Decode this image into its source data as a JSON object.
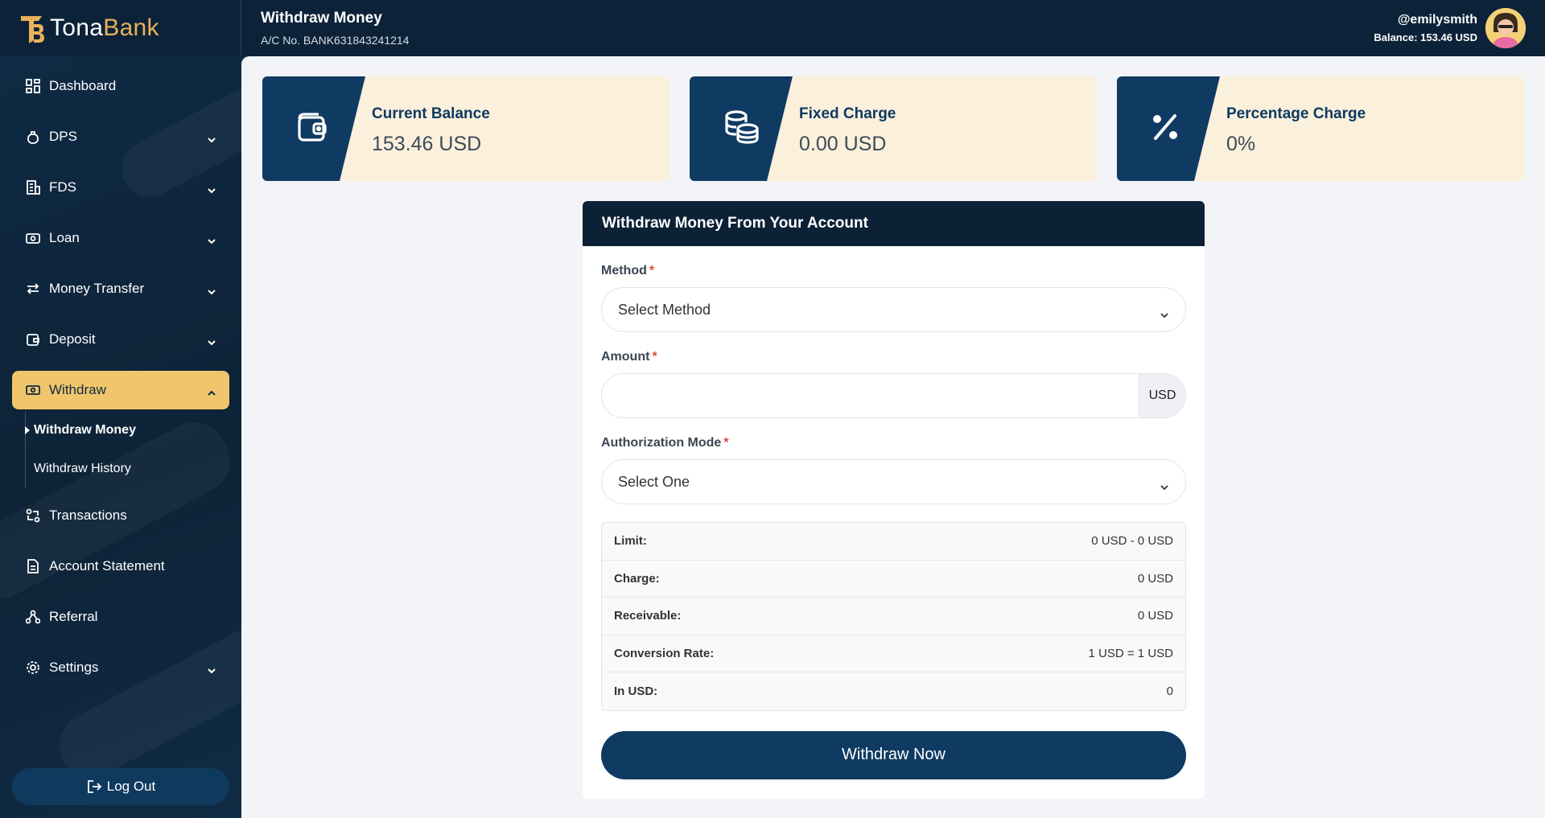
{
  "brand": {
    "part1": "Tona",
    "part2": "Bank"
  },
  "header": {
    "title": "Withdraw Money",
    "account": "A/C No. BANK631843241214",
    "username": "@emilysmith",
    "balance_label": "Balance:",
    "balance_value": "153.46 USD"
  },
  "sidebar": {
    "items": [
      {
        "label": "Dashboard"
      },
      {
        "label": "DPS"
      },
      {
        "label": "FDS"
      },
      {
        "label": "Loan"
      },
      {
        "label": "Money Transfer"
      },
      {
        "label": "Deposit"
      },
      {
        "label": "Withdraw"
      },
      {
        "label": "Transactions"
      },
      {
        "label": "Account Statement"
      },
      {
        "label": "Referral"
      },
      {
        "label": "Settings"
      }
    ],
    "withdraw_sub": [
      {
        "label": "Withdraw Money"
      },
      {
        "label": "Withdraw History"
      }
    ],
    "logout": "Log Out"
  },
  "cards": [
    {
      "title": "Current Balance",
      "value": "153.46 USD",
      "icon": "wallet-icon"
    },
    {
      "title": "Fixed Charge",
      "value": "0.00 USD",
      "icon": "coins-icon"
    },
    {
      "title": "Percentage Charge",
      "value": "0%",
      "icon": "percent-icon"
    }
  ],
  "form": {
    "title": "Withdraw Money From Your Account",
    "method_label": "Method",
    "method_value": "Select Method",
    "amount_label": "Amount",
    "amount_value": "",
    "amount_unit": "USD",
    "auth_label": "Authorization Mode",
    "auth_value": "Select One",
    "required_mark": "*",
    "summary": [
      {
        "key": "Limit:",
        "value": "0 USD - 0 USD"
      },
      {
        "key": "Charge:",
        "value": "0 USD"
      },
      {
        "key": "Receivable:",
        "value": "0 USD"
      },
      {
        "key": "Conversion Rate:",
        "value": "1 USD = 1 USD"
      },
      {
        "key": "In USD:",
        "value": "0"
      }
    ],
    "submit": "Withdraw Now"
  },
  "colors": {
    "navy": "#0c2239",
    "accent": "#f1c56c",
    "card_bg": "#faf0dc",
    "primary": "#0f3a62"
  }
}
